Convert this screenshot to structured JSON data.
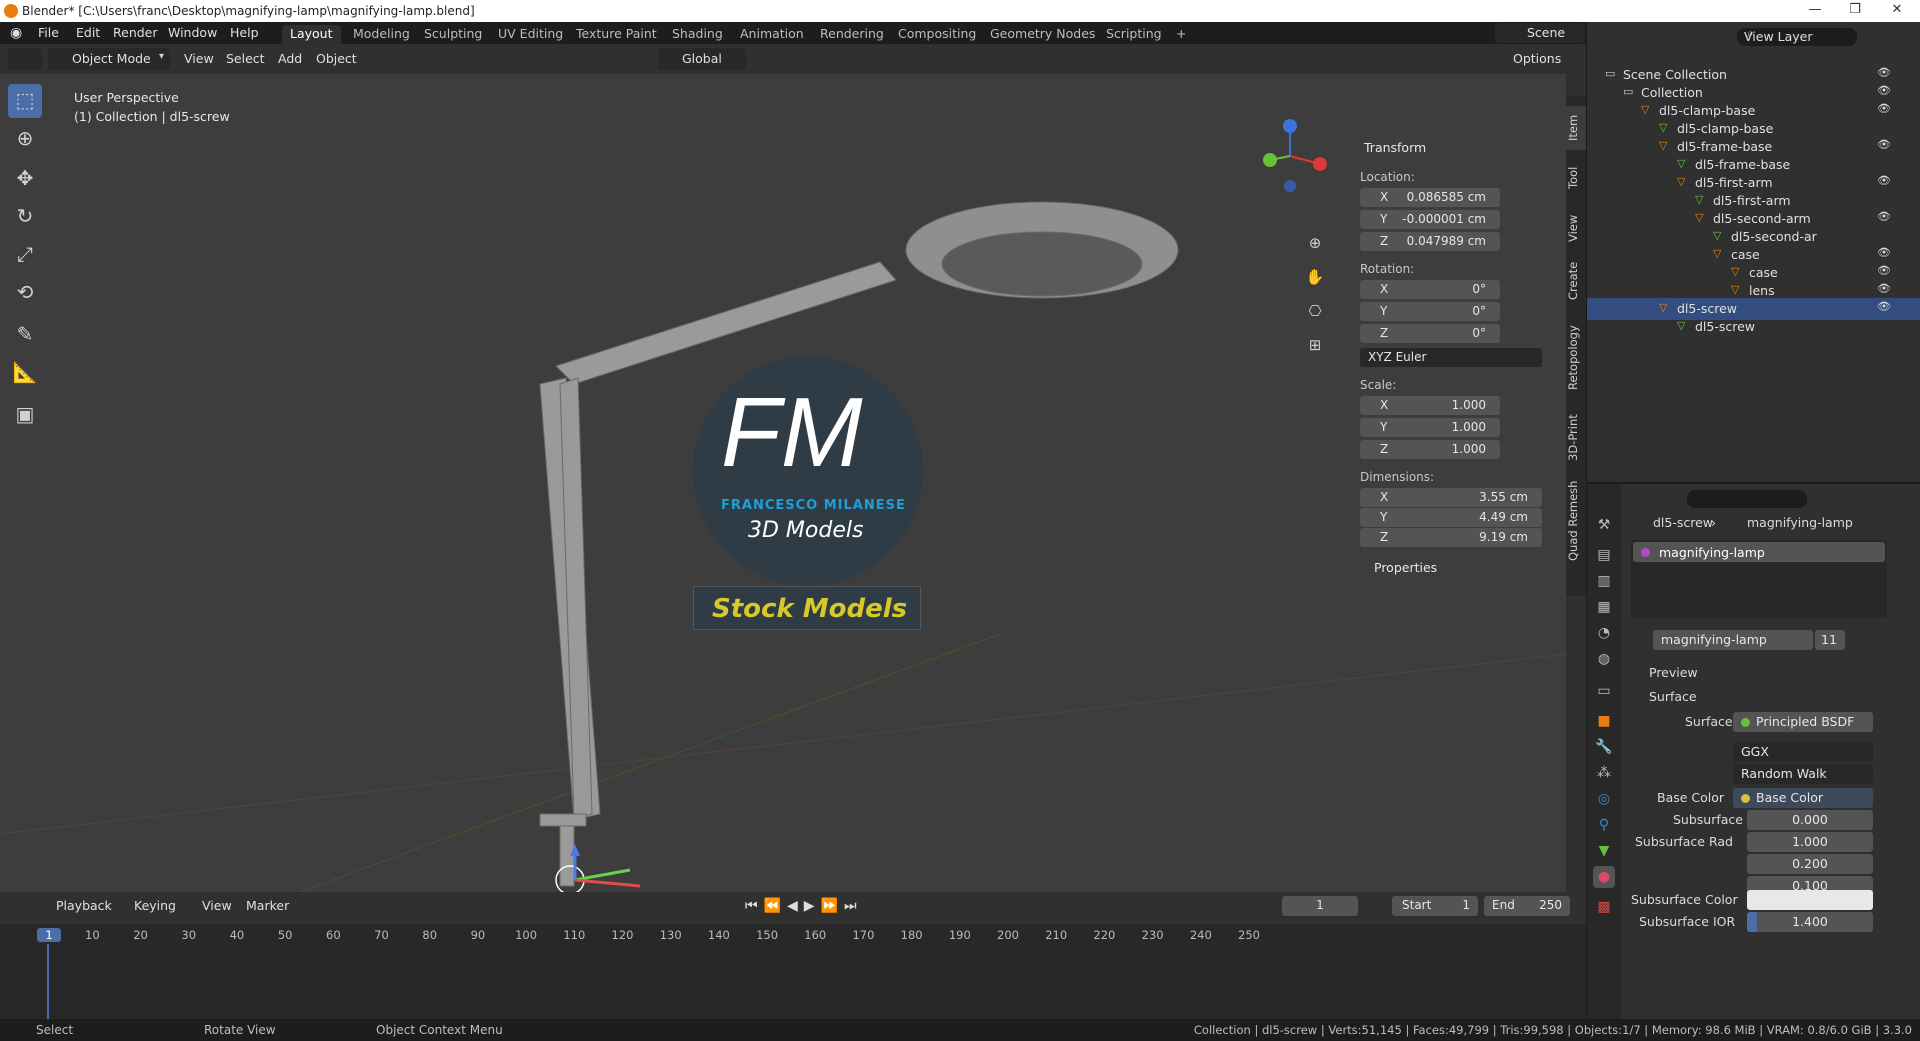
{
  "window": {
    "title": "Blender* [C:\\Users\\franc\\Desktop\\magnifying-lamp\\magnifying-lamp.blend]",
    "minimize": "—",
    "maximize": "❐",
    "close": "✕"
  },
  "menu": [
    "File",
    "Edit",
    "Render",
    "Window",
    "Help"
  ],
  "workspaces": [
    "Layout",
    "Modeling",
    "Sculpting",
    "UV Editing",
    "Texture Paint",
    "Shading",
    "Animation",
    "Rendering",
    "Compositing",
    "Geometry Nodes",
    "Scripting",
    "+"
  ],
  "scene": {
    "label": "Scene",
    "view_layer": "View Layer"
  },
  "header": {
    "mode": "Object Mode",
    "view": "View",
    "select": "Select",
    "add": "Add",
    "object": "Object",
    "orientation": "Global",
    "options": "Options"
  },
  "viewport": {
    "perspective": "User Perspective",
    "collection": "(1) Collection | dl5-screw"
  },
  "logo": {
    "letters": "FM",
    "name": "FRANCESCO MILANESE",
    "sub": "3D Models",
    "banner": "Stock Models"
  },
  "transform": {
    "title": "Transform",
    "location_label": "Location:",
    "location": [
      {
        "k": "X",
        "v": "0.086585 cm"
      },
      {
        "k": "Y",
        "v": "-0.000001 cm"
      },
      {
        "k": "Z",
        "v": "0.047989 cm"
      }
    ],
    "rotation_label": "Rotation:",
    "rotation": [
      {
        "k": "X",
        "v": "0°"
      },
      {
        "k": "Y",
        "v": "0°"
      },
      {
        "k": "Z",
        "v": "0°"
      }
    ],
    "rotation_mode": "XYZ Euler",
    "scale_label": "Scale:",
    "scale": [
      {
        "k": "X",
        "v": "1.000"
      },
      {
        "k": "Y",
        "v": "1.000"
      },
      {
        "k": "Z",
        "v": "1.000"
      }
    ],
    "dimensions_label": "Dimensions:",
    "dimensions": [
      {
        "k": "X",
        "v": "3.55 cm"
      },
      {
        "k": "Y",
        "v": "4.49 cm"
      },
      {
        "k": "Z",
        "v": "9.19 cm"
      }
    ],
    "properties": "Properties"
  },
  "side_tabs": [
    "Item",
    "Tool",
    "View",
    "Create",
    "Retopology",
    "3D-Print",
    "Quad Remesh"
  ],
  "outliner": {
    "rows": [
      {
        "label": "Scene Collection",
        "indent": 0,
        "icon": "box"
      },
      {
        "label": "Collection",
        "indent": 1,
        "icon": "box"
      },
      {
        "label": "dl5-clamp-base",
        "indent": 2,
        "icon": "tri"
      },
      {
        "label": "dl5-clamp-base",
        "indent": 3,
        "icon": "mesh"
      },
      {
        "label": "dl5-frame-base",
        "indent": 3,
        "icon": "tri"
      },
      {
        "label": "dl5-frame-base",
        "indent": 4,
        "icon": "mesh"
      },
      {
        "label": "dl5-first-arm",
        "indent": 4,
        "icon": "tri"
      },
      {
        "label": "dl5-first-arm",
        "indent": 5,
        "icon": "mesh"
      },
      {
        "label": "dl5-second-arm",
        "indent": 5,
        "icon": "tri"
      },
      {
        "label": "dl5-second-ar",
        "indent": 6,
        "icon": "mesh"
      },
      {
        "label": "case",
        "indent": 6,
        "icon": "tri"
      },
      {
        "label": "case",
        "indent": 7,
        "icon": "tri"
      },
      {
        "label": "lens",
        "indent": 7,
        "icon": "tri"
      },
      {
        "label": "dl5-screw",
        "indent": 3,
        "icon": "tri",
        "selected": true
      },
      {
        "label": "dl5-screw",
        "indent": 4,
        "icon": "mesh"
      }
    ]
  },
  "properties": {
    "breadcrumb_obj": "dl5-screw",
    "breadcrumb_mat": "magnifying-lamp",
    "slot": "magnifying-lamp",
    "material": "magnifying-lamp",
    "users": "11",
    "preview": "Preview",
    "surface_section": "Surface",
    "surface_label": "Surface",
    "surface_value": "Principled BSDF",
    "dist": "GGX",
    "sss_method": "Random Walk",
    "base_color_label": "Base Color",
    "base_color_value": "Base Color",
    "subsurface_label": "Subsurface",
    "subsurface_value": "0.000",
    "ssr_label": "Subsurface Rad",
    "ssr": [
      "1.000",
      "0.200",
      "0.100"
    ],
    "ssc_label": "Subsurface Color",
    "ssior_label": "Subsurface IOR",
    "ssior_value": "1.400"
  },
  "timeline": {
    "playback": "Playback",
    "keying": "Keying",
    "view": "View",
    "marker": "Marker",
    "current": "1",
    "start_label": "Start",
    "start": "1",
    "end_label": "End",
    "end": "250",
    "ticks": [
      "1",
      "10",
      "20",
      "30",
      "40",
      "50",
      "60",
      "70",
      "80",
      "90",
      "100",
      "110",
      "120",
      "130",
      "140",
      "150",
      "160",
      "170",
      "180",
      "190",
      "200",
      "210",
      "220",
      "230",
      "240",
      "250"
    ]
  },
  "status": {
    "select": "Select",
    "rotate": "Rotate View",
    "context": "Object Context Menu",
    "stats": "Collection | dl5-screw | Verts:51,145 | Faces:49,799 | Tris:99,598 | Objects:1/7 | Memory: 98.6 MiB | VRAM: 0.8/6.0 GiB | 3.3.0"
  },
  "colors": {
    "accent": "#4b6ea8",
    "select": "#334d80",
    "orange": "#e87d0d",
    "logo_blue": "#1f9fd6",
    "banner_yellow": "#d8c92a"
  }
}
